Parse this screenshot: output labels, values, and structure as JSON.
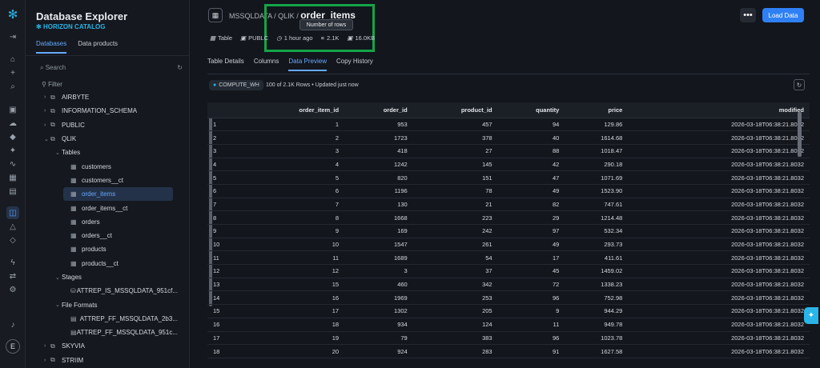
{
  "sidebar": {
    "title": "Database Explorer",
    "catalog": "HORIZON CATALOG",
    "tabs": [
      "Databases",
      "Data products"
    ],
    "search_placeholder": "Search",
    "filter": "Filter",
    "items": [
      "AIRBYTE",
      "INFORMATION_SCHEMA",
      "PUBLIC",
      "QLIK",
      "Tables",
      "customers",
      "customers__ct",
      "order_items",
      "order_items__ct",
      "orders",
      "orders__ct",
      "products",
      "products__ct",
      "Stages",
      "ATTREP_IS_MSSQLDATA_951cf...",
      "File Formats",
      "ATTREP_FF_MSSQLDATA_2b3...",
      "ATTREP_FF_MSSQLDATA_951c...",
      "SKYVIA",
      "STRIIM"
    ]
  },
  "header": {
    "path": "MSSQLDATA / QLIK /",
    "name": "order_items",
    "tooltip": "Number of rows",
    "type": "Table",
    "schema": "PUBLC",
    "time": "1 hour ago",
    "rows": "2.1K",
    "size": "16.0KB",
    "load": "Load Data",
    "more": "•••"
  },
  "tabs": [
    "Table Details",
    "Columns",
    "Data Preview",
    "Copy History"
  ],
  "warehouse": "COMPUTE_WH",
  "status": "100 of 2.1K Rows • Updated just now",
  "table": {
    "headers": [
      "",
      "order_item_id",
      "order_id",
      "product_id",
      "quantity",
      "price",
      "modified"
    ],
    "rows": [
      [
        "1",
        "1",
        "953",
        "457",
        "94",
        "129.86",
        "2026-03-18T06:38:21.8032"
      ],
      [
        "2",
        "2",
        "1723",
        "378",
        "40",
        "1614.68",
        "2026-03-18T06:38:21.8032"
      ],
      [
        "3",
        "3",
        "418",
        "27",
        "88",
        "1018.47",
        "2026-03-18T06:38:21.8032"
      ],
      [
        "4",
        "4",
        "1242",
        "145",
        "42",
        "290.18",
        "2026-03-18T06:38:21.8032"
      ],
      [
        "5",
        "5",
        "820",
        "151",
        "47",
        "1071.69",
        "2026-03-18T06:38:21.8032"
      ],
      [
        "6",
        "6",
        "1196",
        "78",
        "49",
        "1523.90",
        "2026-03-18T06:38:21.8032"
      ],
      [
        "7",
        "7",
        "130",
        "21",
        "82",
        "747.61",
        "2026-03-18T06:38:21.8032"
      ],
      [
        "8",
        "8",
        "1668",
        "223",
        "29",
        "1214.48",
        "2026-03-18T06:38:21.8032"
      ],
      [
        "9",
        "9",
        "169",
        "242",
        "97",
        "532.34",
        "2026-03-18T06:38:21.8032"
      ],
      [
        "10",
        "10",
        "1547",
        "261",
        "49",
        "293.73",
        "2026-03-18T06:38:21.8032"
      ],
      [
        "11",
        "11",
        "1689",
        "54",
        "17",
        "411.61",
        "2026-03-18T06:38:21.8032"
      ],
      [
        "12",
        "12",
        "3",
        "37",
        "45",
        "1459.02",
        "2026-03-18T06:38:21.8032"
      ],
      [
        "13",
        "15",
        "460",
        "342",
        "72",
        "1338.23",
        "2026-03-18T06:38:21.8032"
      ],
      [
        "14",
        "16",
        "1969",
        "253",
        "96",
        "752.98",
        "2026-03-18T06:38:21.8032"
      ],
      [
        "15",
        "17",
        "1302",
        "205",
        "9",
        "944.29",
        "2026-03-18T06:38:21.8032"
      ],
      [
        "16",
        "18",
        "934",
        "124",
        "11",
        "949.78",
        "2026-03-18T06:38:21.8032"
      ],
      [
        "17",
        "19",
        "79",
        "383",
        "96",
        "1023.78",
        "2026-03-18T06:38:21.8032"
      ],
      [
        "18",
        "20",
        "924",
        "283",
        "91",
        "1627.58",
        "2026-03-18T06:38:21.8032"
      ]
    ]
  },
  "avatar": "E"
}
